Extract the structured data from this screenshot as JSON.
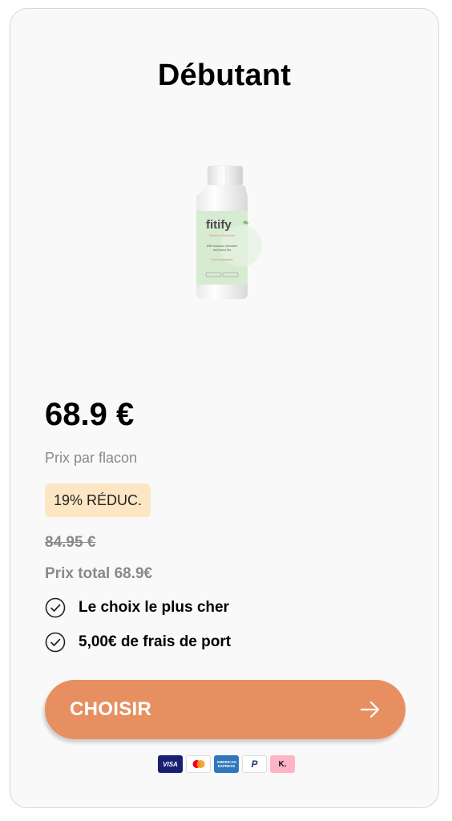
{
  "plan": {
    "title": "Débutant",
    "product_image": "supplement-bottle",
    "product_label": {
      "brand": "fitify",
      "subtitle": "Premium Fat Burner",
      "ingredients_line1": "With Guarana, Chromium",
      "ingredients_line2": "and Green Tea",
      "type": "Food Supplement"
    },
    "price": "68.9 €",
    "price_caption": "Prix par flacon",
    "discount_badge": "19% RÉDUC.",
    "old_price": "84.95 €",
    "total": "Prix total 68.9€",
    "features": [
      {
        "icon": "check-circle-icon",
        "label": "Le choix le plus cher"
      },
      {
        "icon": "check-circle-icon",
        "label": "5,00€ de frais de port"
      }
    ],
    "cta": {
      "label": "CHOISIR",
      "icon": "arrow-right-icon"
    },
    "payment_methods": [
      {
        "name": "visa",
        "label": "VISA"
      },
      {
        "name": "mastercard",
        "label": ""
      },
      {
        "name": "american-express",
        "label": "AMERICAN EXPRESS"
      },
      {
        "name": "paypal",
        "label": "P"
      },
      {
        "name": "klarna",
        "label": "K."
      }
    ]
  },
  "colors": {
    "accent": "#e88f61",
    "badge_bg": "#fde6c4",
    "muted_text": "#8a8a8a",
    "card_bg": "#f9f9f9"
  }
}
